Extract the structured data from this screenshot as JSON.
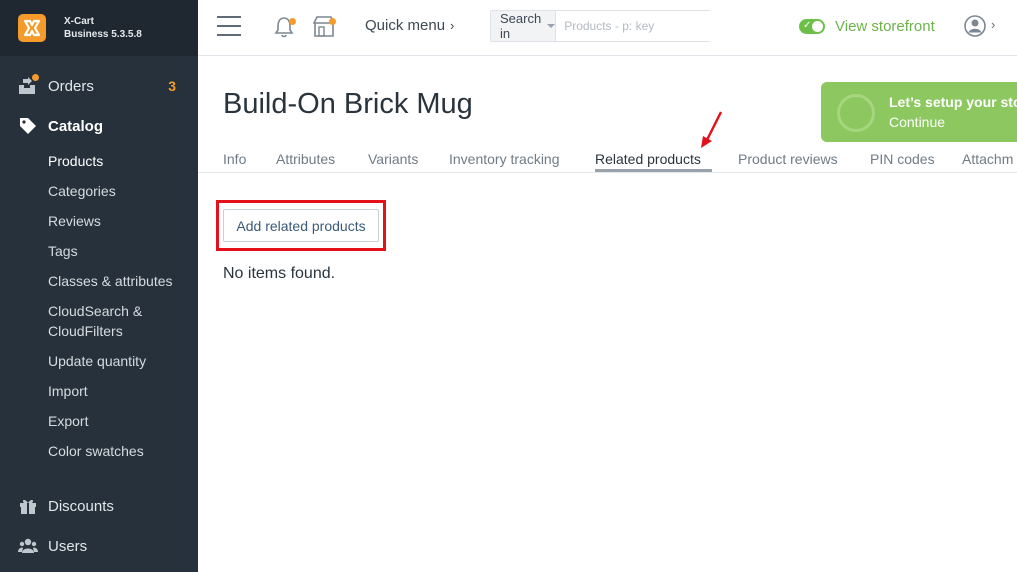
{
  "brand": {
    "name": "X-Cart",
    "edition": "Business 5.3.5.8"
  },
  "sidebar": {
    "orders": {
      "label": "Orders",
      "count": "3"
    },
    "catalog": {
      "label": "Catalog",
      "items": [
        {
          "label": "Products"
        },
        {
          "label": "Categories"
        },
        {
          "label": "Reviews"
        },
        {
          "label": "Tags"
        },
        {
          "label": "Classes & attributes"
        },
        {
          "label": "CloudSearch &",
          "label2": "CloudFilters"
        },
        {
          "label": "Update quantity"
        },
        {
          "label": "Import"
        },
        {
          "label": "Export"
        },
        {
          "label": "Color swatches"
        }
      ]
    },
    "discounts": {
      "label": "Discounts"
    },
    "users": {
      "label": "Users"
    }
  },
  "topbar": {
    "quick_menu": "Quick menu",
    "search_scope": "Search in",
    "search_placeholder": "Products - p: key",
    "view_storefront": "View storefront"
  },
  "main": {
    "title": "Build-On Brick Mug",
    "setup": {
      "line1": "Let’s setup your sto",
      "line2": "Continue"
    },
    "tabs": [
      {
        "label": "Info"
      },
      {
        "label": "Attributes"
      },
      {
        "label": "Variants"
      },
      {
        "label": "Inventory tracking"
      },
      {
        "label": "Related products"
      },
      {
        "label": "Product reviews"
      },
      {
        "label": "PIN codes"
      },
      {
        "label": "Attachm"
      }
    ],
    "active_tab": "Related products",
    "add_button": "Add related products",
    "empty_message": "No items found."
  },
  "colors": {
    "sidebar_bg": "#27313b",
    "accent_orange": "#f59b2b",
    "accent_green": "#6cc04a",
    "highlight_red": "#e3111b"
  },
  "icons": [
    "menu-icon",
    "bell-icon",
    "store-icon",
    "user-icon",
    "orders-icon",
    "tag-icon",
    "gift-icon",
    "users-icon",
    "xcart-logo-icon",
    "arrow-annotation-icon"
  ]
}
